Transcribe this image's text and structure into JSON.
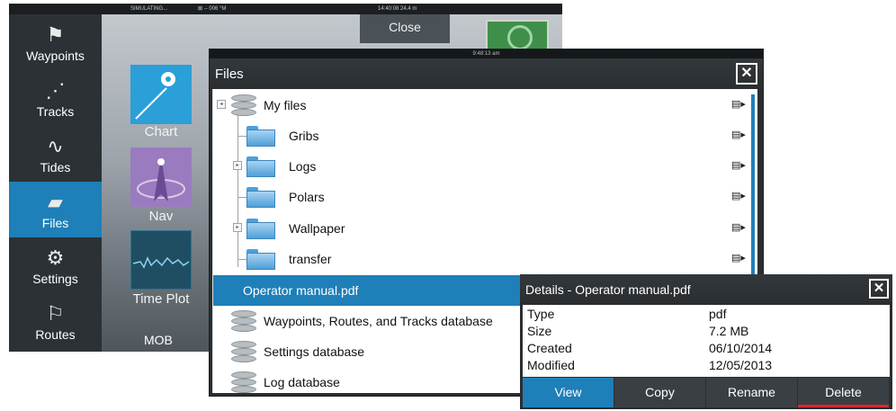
{
  "home": {
    "status_left": "SIMULATING...",
    "status_mid": "⊠ -- 006 °M",
    "status_right": "14:40:08  24.4 m",
    "close_label": "Close",
    "sidebar": [
      {
        "label": "Waypoints",
        "icon": "flag-icon"
      },
      {
        "label": "Tracks",
        "icon": "tracks-icon"
      },
      {
        "label": "Tides",
        "icon": "tides-wave-icon"
      },
      {
        "label": "Files",
        "icon": "folder-icon",
        "active": true
      },
      {
        "label": "Settings",
        "icon": "gear-icon"
      },
      {
        "label": "Routes",
        "icon": "route-flags-icon"
      }
    ],
    "tiles": {
      "chart": "Chart",
      "nav": "Nav",
      "timeplot": "Time Plot",
      "mob": "MOB"
    }
  },
  "files": {
    "status_time": "9:48:13 am",
    "title": "Files",
    "close_glyph": "✕",
    "items": [
      {
        "name": "My files",
        "type": "database",
        "expander": "◂"
      },
      {
        "name": "Gribs",
        "type": "folder"
      },
      {
        "name": "Logs",
        "type": "folder",
        "expander": "▸"
      },
      {
        "name": "Polars",
        "type": "folder"
      },
      {
        "name": "Wallpaper",
        "type": "folder",
        "expander": "▸"
      },
      {
        "name": "transfer",
        "type": "folder"
      },
      {
        "name": "Operator manual.pdf",
        "type": "file",
        "selected": true
      },
      {
        "name": "Waypoints, Routes, and Tracks database",
        "type": "database"
      },
      {
        "name": "Settings database",
        "type": "database"
      },
      {
        "name": "Log database",
        "type": "database"
      }
    ],
    "menu_glyph": "▤▸"
  },
  "details": {
    "title": "Details - Operator manual.pdf",
    "close_glyph": "✕",
    "rows": [
      {
        "key": "Type",
        "value": "pdf"
      },
      {
        "key": "Size",
        "value": "7.2 MB"
      },
      {
        "key": "Created",
        "value": "06/10/2014"
      },
      {
        "key": "Modified",
        "value": "12/05/2013"
      }
    ],
    "buttons": {
      "view": "View",
      "copy": "Copy",
      "rename": "Rename",
      "delete": "Delete"
    }
  },
  "colors": {
    "accent": "#1f7fb8",
    "dialog_dark": "#2a2e31",
    "delete_underline": "#d82a2a"
  }
}
